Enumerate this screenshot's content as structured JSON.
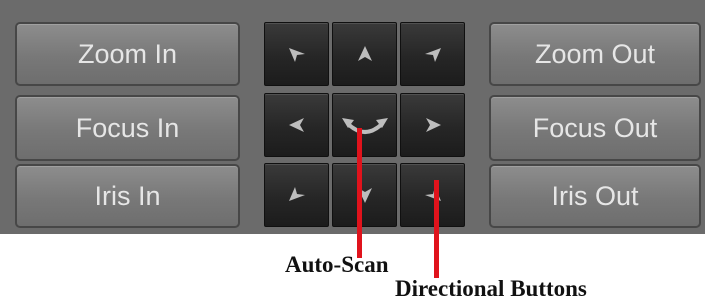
{
  "left_buttons": [
    {
      "label": "Zoom In"
    },
    {
      "label": "Focus In"
    },
    {
      "label": "Iris In"
    }
  ],
  "right_buttons": [
    {
      "label": "Zoom Out"
    },
    {
      "label": "Focus Out"
    },
    {
      "label": "Iris Out"
    }
  ],
  "directional_pad": {
    "buttons": [
      {
        "icon": "arrow-up-left-icon"
      },
      {
        "icon": "arrow-up-icon"
      },
      {
        "icon": "arrow-up-right-icon"
      },
      {
        "icon": "arrow-left-icon"
      },
      {
        "icon": "auto-scan-icon"
      },
      {
        "icon": "arrow-right-icon"
      },
      {
        "icon": "arrow-down-left-icon"
      },
      {
        "icon": "arrow-down-icon"
      },
      {
        "icon": "arrow-down-right-icon"
      }
    ]
  },
  "annotations": {
    "auto_scan": "Auto-Scan",
    "directional_buttons": "Directional Buttons"
  },
  "colors": {
    "panel": "#6b6b6b",
    "callout_line": "#e0131c",
    "button_text": "#e6e6e6",
    "dir_button": "#262626",
    "dir_arrow": "#bdbdbd"
  }
}
